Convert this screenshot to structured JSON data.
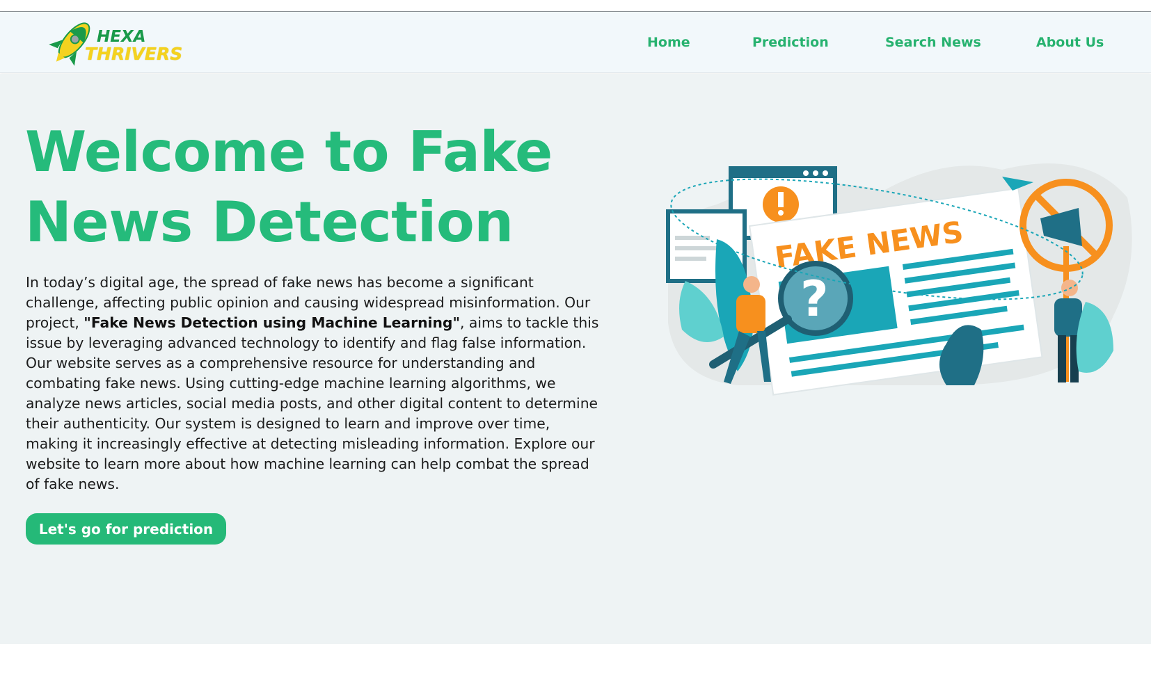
{
  "brand": {
    "name_line1": "HEXA",
    "name_line2": "THRIVERS",
    "primary_color": "#25bb7b",
    "logo_accent_color": "#f4d21f"
  },
  "nav": {
    "items": [
      {
        "label": "Home"
      },
      {
        "label": "Prediction"
      },
      {
        "label": "Search News"
      },
      {
        "label": "About Us"
      }
    ]
  },
  "hero": {
    "title": "Welcome to Fake News Detection",
    "paragraph_before": "In today’s digital age, the spread of fake news has become a significant challenge, affecting public opinion and causing widespread misinformation. Our project, ",
    "paragraph_bold": "\"Fake News Detection using Machine Learning\"",
    "paragraph_after": ", aims to tackle this issue by leveraging advanced technology to identify and flag false information. Our website serves as a comprehensive resource for understanding and combating fake news. Using cutting-edge machine learning algorithms, we analyze news articles, social media posts, and other digital content to determine their authenticity. Our system is designed to learn and improve over time, making it increasingly effective at detecting misleading information. Explore our website to learn more about how machine learning can help combat the spread of fake news.",
    "cta_label": "Let's go for prediction"
  },
  "illustration": {
    "headline": "FAKE NEWS",
    "icons": [
      "newspaper-icon",
      "magnifier-icon",
      "question-mark-icon",
      "megaphone-icon",
      "prohibited-sign-icon",
      "exclamation-icon",
      "browser-window-icon",
      "paper-plane-icon"
    ],
    "colors": {
      "teal": "#1aa6b7",
      "dark_teal": "#1f6f86",
      "orange": "#f7901e",
      "mint": "#5fd0cf"
    }
  }
}
